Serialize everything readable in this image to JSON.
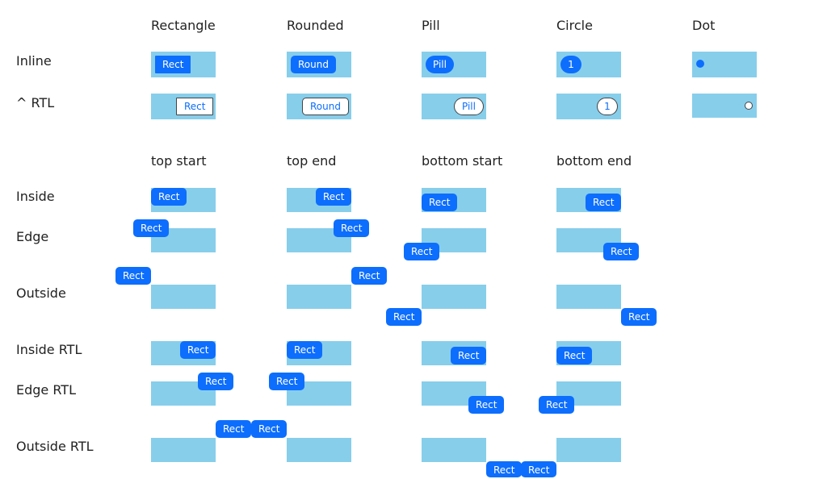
{
  "columns_top": [
    "Rectangle",
    "Rounded",
    "Pill",
    "Circle",
    "Dot"
  ],
  "rows_top": [
    "Inline",
    "^ RTL"
  ],
  "columns_bottom": [
    "top start",
    "top end",
    "bottom start",
    "bottom end"
  ],
  "rows_bottom": [
    "Inside",
    "Edge",
    "Outside",
    "Inside RTL",
    "Edge RTL",
    "Outside RTL"
  ],
  "badges": {
    "rect": "Rect",
    "round": "Round",
    "pill": "Pill",
    "circle": "1"
  },
  "colors": {
    "accent": "#0d6efd",
    "box": "#87ceeb",
    "text": "#222222"
  }
}
